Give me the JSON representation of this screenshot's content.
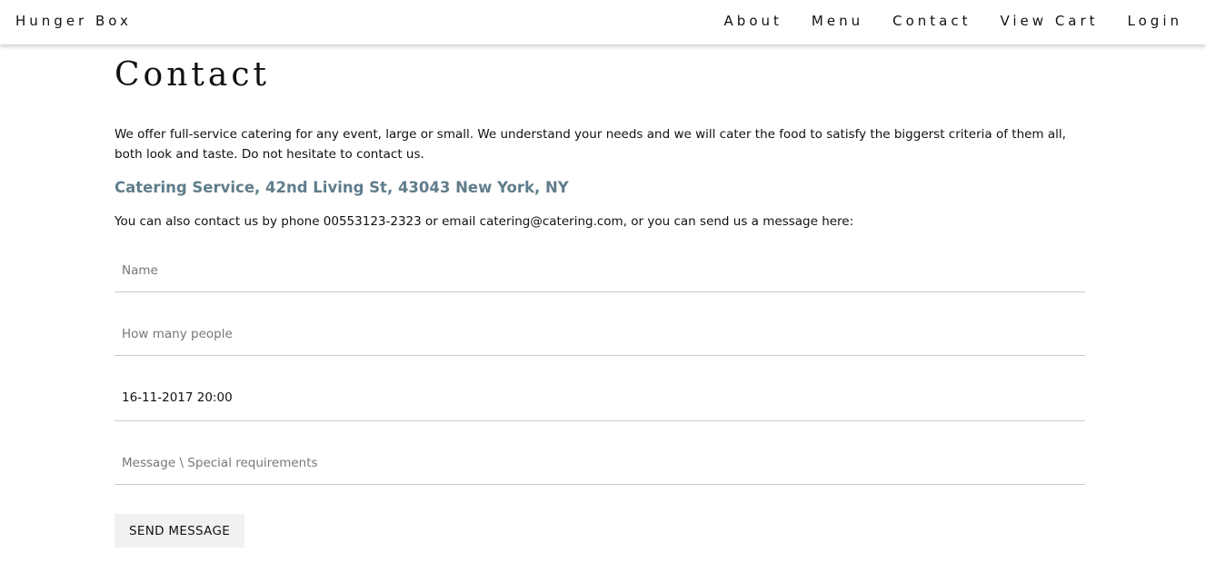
{
  "header": {
    "brand": "Hunger Box",
    "nav": {
      "about": "About",
      "menu": "Menu",
      "contact": "Contact",
      "view_cart": "View Cart",
      "login": "Login"
    }
  },
  "main": {
    "title": "Contact",
    "intro": "We offer full-service catering for any event, large or small. We understand your needs and we will cater the food to satisfy the biggerst criteria of them all, both look and taste. Do not hesitate to contact us.",
    "address": "Catering Service, 42nd Living St, 43043 New York, NY",
    "contact_line": "You can also contact us by phone 00553123-2323 or email catering@catering.com, or you can send us a message here:",
    "form": {
      "name_placeholder": "Name",
      "people_placeholder": "How many people",
      "datetime_value": "16-11-2017 20:00",
      "message_placeholder": "Message \\ Special requirements",
      "send_label": "SEND MESSAGE"
    }
  },
  "colors": {
    "address": "#607d8b",
    "button_bg": "#f1f1f1"
  }
}
